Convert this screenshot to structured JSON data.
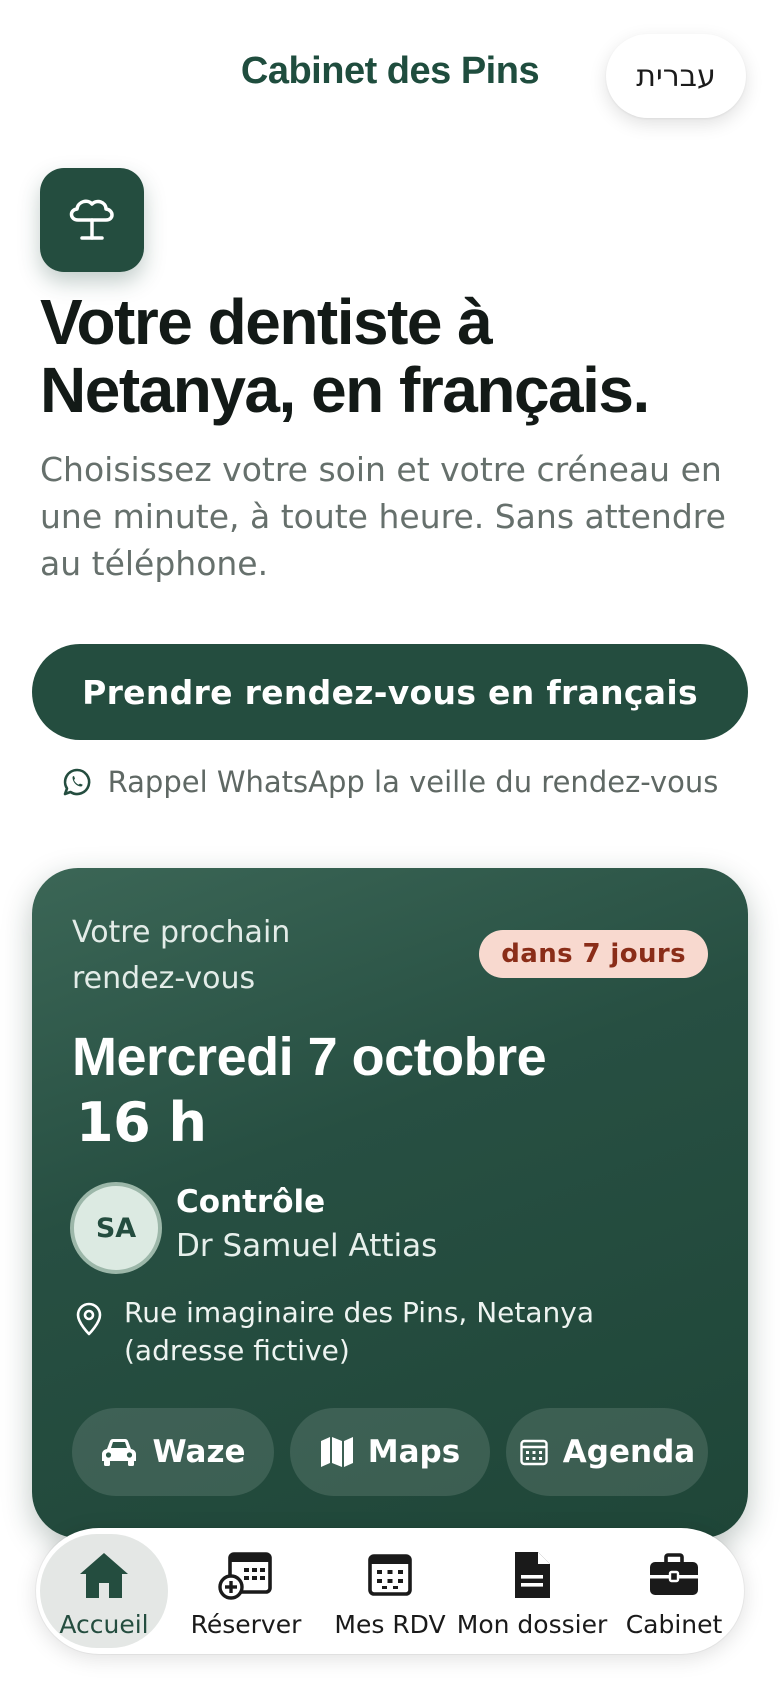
{
  "header": {
    "brand": "Cabinet des Pins",
    "language_button": "עברית"
  },
  "hero": {
    "logo_icon": "tree-icon",
    "title": "Votre dentiste à Netanya, en français.",
    "subtitle": "Choisissez votre soin et votre créneau en une minute, à toute heure. Sans attendre au téléphone.",
    "cta_label": "Prendre rendez-vous en français",
    "reminder_icon": "whatsapp-icon",
    "reminder_text": "Rappel WhatsApp la veille du rendez-vous"
  },
  "appointment": {
    "label": "Votre prochain rendez-vous",
    "badge": "dans 7 jours",
    "date": "Mercredi 7 octobre",
    "time": "16 h",
    "avatar_initials": "SA",
    "service": "Contrôle",
    "doctor": "Dr Samuel Attias",
    "address": "Rue imaginaire des Pins, Netanya (adresse fictive)",
    "actions": [
      {
        "label": "Waze",
        "icon": "car-icon"
      },
      {
        "label": "Maps",
        "icon": "map-icon"
      },
      {
        "label": "Agenda",
        "icon": "calendar-icon"
      }
    ]
  },
  "nav": {
    "items": [
      {
        "label": "Accueil",
        "icon": "home-icon",
        "active": true
      },
      {
        "label": "Réserver",
        "icon": "calendar-plus-icon",
        "active": false
      },
      {
        "label": "Mes RDV",
        "icon": "calendar-icon",
        "active": false
      },
      {
        "label": "Mon dossier",
        "icon": "document-icon",
        "active": false
      },
      {
        "label": "Cabinet",
        "icon": "briefcase-icon",
        "active": false
      }
    ]
  },
  "colors": {
    "primary": "#244d3f",
    "badge_bg": "#f8d9cf",
    "badge_text": "#8a2d18",
    "nav_active_bg": "#e4e7e5"
  }
}
